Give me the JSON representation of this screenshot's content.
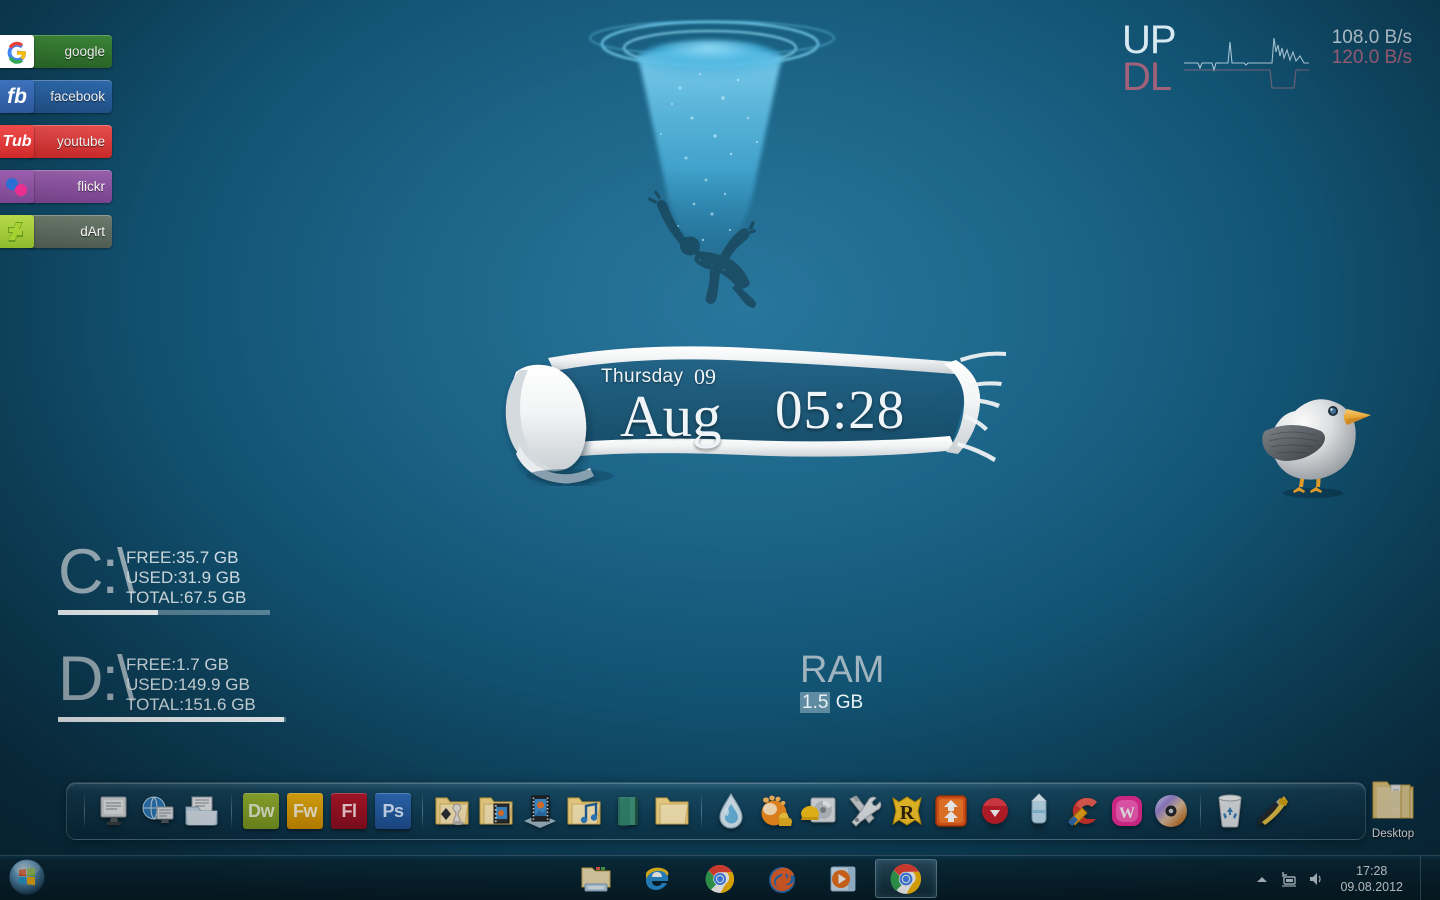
{
  "desktop": {
    "wallpaper_description": "Underwater diver falling into bubble plume",
    "background_color": "#11506f",
    "accent_color": "#1d6f97"
  },
  "social_links": [
    {
      "name": "google",
      "badge": "G",
      "label": "google",
      "badge_color": "#ffffff",
      "label_color": "#3f8f3c"
    },
    {
      "name": "facebook",
      "badge": "fb",
      "label": "facebook",
      "badge_color": "#3d72bd",
      "label_color": "#2f6fb5"
    },
    {
      "name": "youtube",
      "badge": "Tub",
      "label": "youtube",
      "badge_color": "#ef4b4b",
      "label_color": "#f15252"
    },
    {
      "name": "flickr",
      "badge": "",
      "label": "flickr",
      "badge_color": "#9a5fae",
      "label_color": "#9d63b0"
    },
    {
      "name": "dart",
      "badge": "",
      "label": "dArt",
      "badge_color": "#b6d94a",
      "label_color": "#6e7d6f"
    }
  ],
  "network_monitor": {
    "upload_label": "UP",
    "download_label": "DL",
    "upload_value": "108.0 B/s",
    "download_value": "120.0 B/s",
    "upload_color": "#d9e9f2",
    "download_color": "#a0607a"
  },
  "clock_widget": {
    "weekday": "Thursday",
    "day": "09",
    "month": "Aug",
    "time": "05:28"
  },
  "drives": [
    {
      "letter": "C:\\",
      "free": "FREE:35.7 GB",
      "used": "USED:31.9 GB",
      "total": "TOTAL:67.5 GB",
      "used_percent": 47
    },
    {
      "letter": "D:\\",
      "free": "FREE:1.7 GB",
      "used": "USED:149.9 GB",
      "total": "TOTAL:151.6 GB",
      "used_percent": 99
    }
  ],
  "ram_widget": {
    "title": "RAM",
    "value": "1.5",
    "unit": "GB"
  },
  "dock": {
    "groups": [
      {
        "name": "system",
        "items": [
          {
            "name": "my-computer-icon",
            "label": "My Computer"
          },
          {
            "name": "network-icon",
            "label": "Network"
          },
          {
            "name": "documents-icon",
            "label": "Documents"
          }
        ]
      },
      {
        "name": "adobe",
        "items": [
          {
            "name": "dreamweaver-icon",
            "label": "Dw",
            "color": "#9bbb33"
          },
          {
            "name": "fireworks-icon",
            "label": "Fw",
            "color": "#f0b510"
          },
          {
            "name": "flash-icon",
            "label": "Fl",
            "color": "#b5172b"
          },
          {
            "name": "photoshop-icon",
            "label": "Ps",
            "color": "#2e6fbd"
          }
        ]
      },
      {
        "name": "folders",
        "items": [
          {
            "name": "games-folder-icon",
            "label": "Games"
          },
          {
            "name": "videos-folder-icon",
            "label": "Videos"
          },
          {
            "name": "media-photo-icon",
            "label": "Media"
          },
          {
            "name": "music-folder-icon",
            "label": "Music"
          },
          {
            "name": "book-icon",
            "label": "Books"
          },
          {
            "name": "plain-folder-icon",
            "label": "Folder"
          }
        ]
      },
      {
        "name": "apps",
        "items": [
          {
            "name": "water-drop-icon",
            "label": "Rainmeter"
          },
          {
            "name": "gom-player-icon",
            "label": "GOM Player"
          },
          {
            "name": "disk-utility-icon",
            "label": "Disk Tools"
          },
          {
            "name": "tools-icon",
            "label": "Tools"
          },
          {
            "name": "rockstar-r-icon",
            "label": "R"
          },
          {
            "name": "download-manager-icon",
            "label": "Downloader"
          },
          {
            "name": "red-download-icon",
            "label": "Download"
          },
          {
            "name": "usb-eraser-icon",
            "label": "USB"
          },
          {
            "name": "ccleaner-icon",
            "label": "CCleaner"
          },
          {
            "name": "winamp-w-icon",
            "label": "W"
          },
          {
            "name": "disc-icon",
            "label": "Disc"
          }
        ]
      },
      {
        "name": "utilities",
        "items": [
          {
            "name": "recycle-bin-icon",
            "label": "Recycle Bin"
          },
          {
            "name": "settings-tools-icon",
            "label": "Settings"
          }
        ]
      }
    ]
  },
  "desktop_folder": {
    "label": "Desktop"
  },
  "taskbar": {
    "start_label": "Start",
    "pinned": [
      {
        "name": "file-explorer-icon",
        "label": "Windows Explorer",
        "active": false
      },
      {
        "name": "internet-explorer-icon",
        "label": "Internet Explorer",
        "active": false
      },
      {
        "name": "chrome-icon",
        "label": "Google Chrome",
        "active": false
      },
      {
        "name": "firefox-icon",
        "label": "Mozilla Firefox",
        "active": false
      },
      {
        "name": "media-player-icon",
        "label": "Windows Media Player",
        "active": false
      },
      {
        "name": "chrome-window-icon",
        "label": "Google Chrome",
        "active": true
      }
    ],
    "tray": {
      "show_hidden_label": "Show hidden icons",
      "network_label": "Network",
      "volume_label": "Volume",
      "time": "17:28",
      "date": "09.08.2012"
    }
  }
}
